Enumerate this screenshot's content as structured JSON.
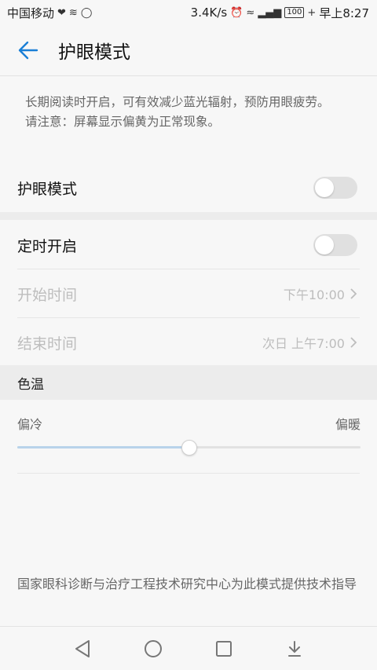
{
  "status_bar": {
    "carrier": "中国移动",
    "speed": "3.4K/s",
    "battery": "100",
    "time": "早上8:27"
  },
  "header": {
    "title": "护眼模式"
  },
  "description": {
    "line1": "长期阅读时开启，可有效减少蓝光辐射，预防用眼疲劳。",
    "line2": "请注意：屏幕显示偏黄为正常现象。"
  },
  "eye_mode": {
    "label": "护眼模式",
    "enabled": false
  },
  "schedule": {
    "label": "定时开启",
    "enabled": false,
    "start": {
      "label": "开始时间",
      "value": "下午10:00"
    },
    "end": {
      "label": "结束时间",
      "value": "次日 上午7:00"
    }
  },
  "color_temp": {
    "section_title": "色温",
    "cool_label": "偏冷",
    "warm_label": "偏暖",
    "level": 0.5
  },
  "footer": {
    "note": "国家眼科诊断与治疗工程技术研究中心为此模式提供技术指导"
  },
  "colors": {
    "accent": "#1a7fd6",
    "slider_fill": "#b9d3ea"
  }
}
